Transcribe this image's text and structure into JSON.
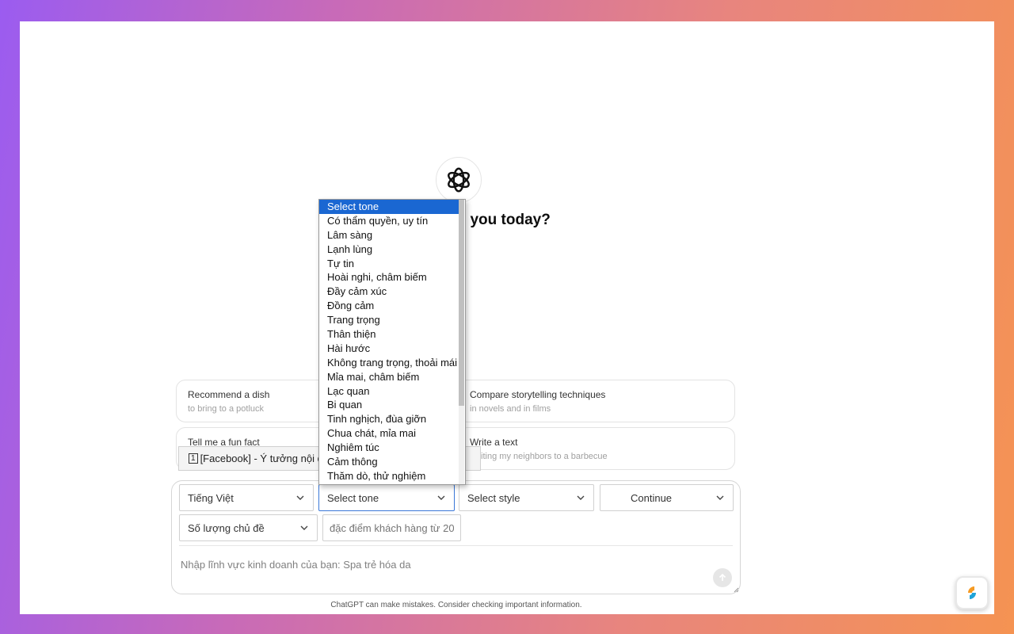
{
  "headline": "How can I help you today?",
  "suggestions": [
    {
      "title": "Recommend a dish",
      "subtitle": "to bring to a potluck"
    },
    {
      "title": "Compare storytelling techniques",
      "subtitle": "in novels and in films"
    },
    {
      "title": "Tell me a fun fact",
      "subtitle": ""
    },
    {
      "title": "Write a text",
      "subtitle": "inviting my neighbors to a barbecue"
    }
  ],
  "tooltip": {
    "number": "1",
    "text": "[Facebook] - Ý tưởng nội dung cho ngành"
  },
  "selects": {
    "language": "Tiếng Việt",
    "tone": "Select tone",
    "style": "Select style",
    "continue": "Continue",
    "count": "Số lượng chủ đề"
  },
  "customer_input": {
    "placeholder": "đặc điểm khách hàng từ 20"
  },
  "message_input": {
    "placeholder": "Nhập lĩnh vực kinh doanh của bạn: Spa trẻ hóa da"
  },
  "footer": "ChatGPT can make mistakes. Consider checking important information.",
  "tone_options": [
    "Select tone",
    "Có thẩm quyền, uy tín",
    "Lâm sàng",
    "Lạnh lùng",
    "Tự tin",
    "Hoài nghi, châm biếm",
    "Đầy cảm xúc",
    "Đồng cảm",
    "Trang trọng",
    "Thân thiện",
    "Hài hước",
    "Không trang trọng, thoải mái",
    "Mỉa mai, châm biếm",
    "Lạc quan",
    "Bi quan",
    "Tinh nghịch, đùa giỡn",
    "Chua chát, mỉa mai",
    "Nghiêm túc",
    "Cảm thông",
    "Thăm dò, thử nghiệm"
  ],
  "colors": {
    "selected_option": "#1a67d2",
    "active_border": "#3b78d8"
  }
}
